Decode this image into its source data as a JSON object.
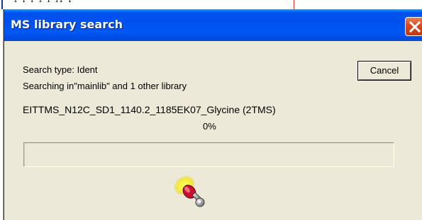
{
  "dialog": {
    "title": "MS library search",
    "search_type": "Search type: Ident",
    "searching_in": "Searching in\"mainlib\" and 1 other library",
    "compound": "EITTMS_N12C_SD1_1140.2_1185EK07_Glycine (2TMS)",
    "progress_text": "0%",
    "progress_fraction": 0,
    "cancel_label": "Cancel",
    "close_icon": "close-icon",
    "animation_icon": "searchlight-icon"
  },
  "colors": {
    "titlebar": "#0054e3",
    "dialog_face": "#ece9d8",
    "close_button": "#d8481f",
    "progress_fill": "#316ac5"
  }
}
